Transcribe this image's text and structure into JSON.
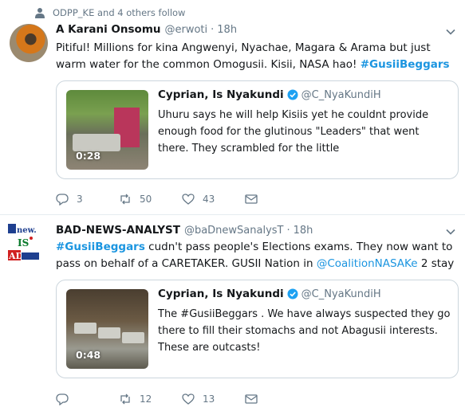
{
  "social_context": {
    "text": "ODPP_KE and 4 others follow",
    "icon": "person-icon"
  },
  "tweets": [
    {
      "fullname": "A Karani Onsomu",
      "username": "@erwoti",
      "dot": "·",
      "time": "18h",
      "text": {
        "part1": "Pitiful! Millions for kina Angwenyi, Nyachae, Magara & Arama but just warm water for the common Omogusii. Kisii, NASA hao! ",
        "hashtag": "#GusiiBeggars"
      },
      "quote": {
        "name": "Cyprian, Is Nyakundi",
        "username": "@C_NyaKundiH",
        "text": "Uhuru says he will help Kisiis yet he couldnt provide enough food for the glutinous \"Leaders\" that went there. They scrambled for the little",
        "duration": "0:28"
      },
      "replies": "3",
      "retweets": "50",
      "likes": "43"
    },
    {
      "fullname": "BAD-NEWS-ANALYST",
      "username": "@baDnewSanalysT",
      "dot": "·",
      "time": "18h",
      "avatar_text": {
        "line1": "new.",
        "line2": "IS",
        "line3": "AD"
      },
      "text": {
        "hashtag": "#GusiiBeggars",
        "part1": " cudn't pass people's Elections exams. They now want to pass on behalf of a CARETAKER. GUSII Nation in ",
        "mention": "@CoalitionNASAKe",
        "part2": " 2 stay"
      },
      "quote": {
        "name": "Cyprian, Is Nyakundi",
        "username": "@C_NyaKundiH",
        "text": "The #GusiiBeggars . We have always suspected they go there to fill their stomachs and not Abagusii interests. These are outcasts!",
        "duration": "0:48"
      },
      "replies": "",
      "retweets": "12",
      "likes": "13"
    }
  ],
  "colors": {
    "accent": "#1b95e0",
    "muted": "#657786",
    "border": "#ccd6dd"
  }
}
